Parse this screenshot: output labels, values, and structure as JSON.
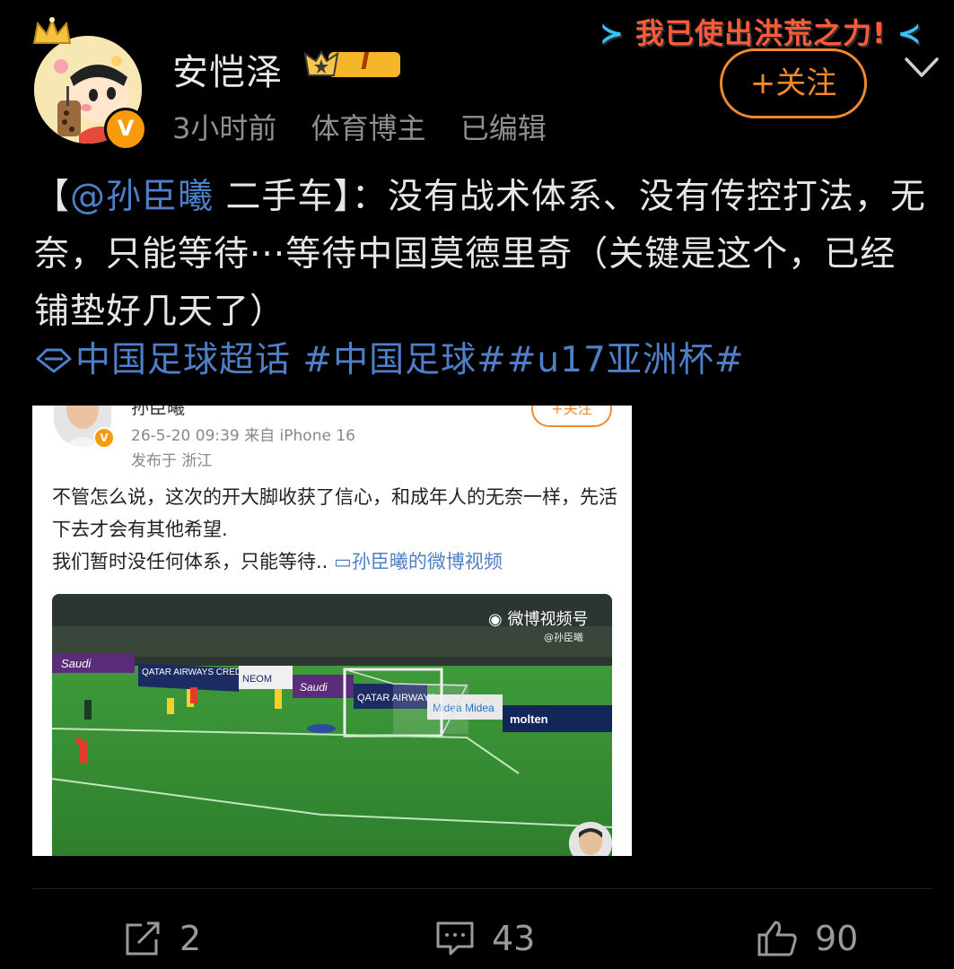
{
  "header": {
    "user_name": "安恺泽",
    "level_badge": "I",
    "verified_badge": "V",
    "meta": [
      "3小时前",
      "体育博主",
      "已编辑"
    ],
    "follow_label": "+关注",
    "slogan": "我已使出洪荒之力!"
  },
  "post": {
    "text_open": "【",
    "mention": "@孙臣曦",
    "text_rest": " 二手车】：没有战术体系、没有传控打法，无奈，只能等待···等待中国莫德里奇（关键是这个，已经铺垫好几天了）",
    "topics": "中国足球超话 #中国足球##u17亚洲杯#"
  },
  "embed": {
    "name": "孙臣曦",
    "follow_label": "+关注",
    "time_source": "26-5-20 09:39  来自 iPhone 16",
    "location": "发布于 浙江",
    "text": "不管怎么说，这次的开大脚收获了信心，和成年人的无奈一样，先活下去才会有其他希望.",
    "text_line3": "我们暂时没任何体系，只能等待..",
    "video_link": "孙臣曦的微博视频",
    "video_watermark": "微博视频号",
    "video_watermark_sub": "@孙臣曦",
    "ad_boards": [
      "Saudi",
      "QATAR AIRWAYS CREDIT SAISON",
      "NEOM",
      "Saudi",
      "QATAR AIRWAYS",
      "Midea",
      "Midea",
      "molten"
    ]
  },
  "actions": {
    "repost_count": "2",
    "comment_count": "43",
    "like_count": "90"
  },
  "colors": {
    "background": "#000000",
    "link": "#4f7fc6",
    "accent": "#f08a2c",
    "secondary_text": "#8f8f8f"
  }
}
